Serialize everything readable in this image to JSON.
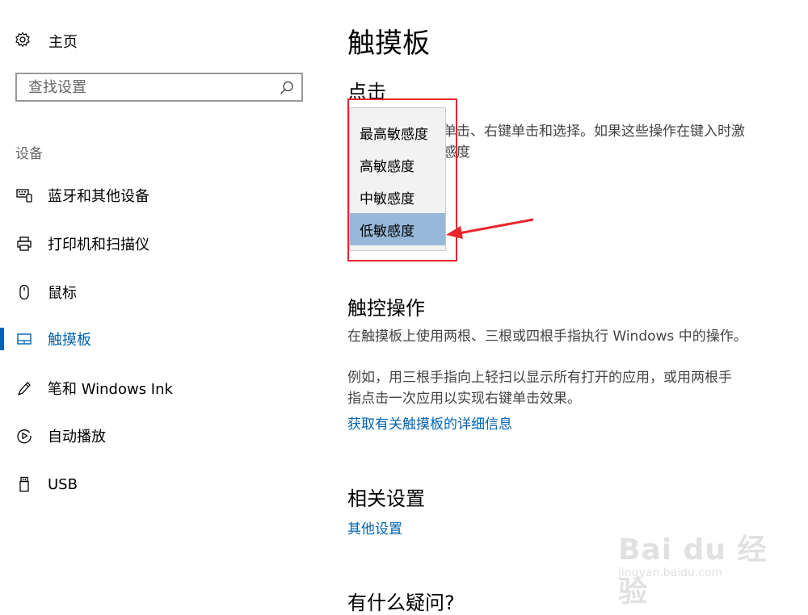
{
  "sidebar": {
    "home_label": "主页",
    "search_placeholder": "查找设置",
    "section_label": "设备",
    "items": [
      {
        "label": "蓝牙和其他设备",
        "icon": "bluetooth-devices-icon"
      },
      {
        "label": "打印机和扫描仪",
        "icon": "printer-icon"
      },
      {
        "label": "鼠标",
        "icon": "mouse-icon"
      },
      {
        "label": "触摸板",
        "icon": "touchpad-icon",
        "active": true
      },
      {
        "label": "笔和 Windows Ink",
        "icon": "pen-icon"
      },
      {
        "label": "自动播放",
        "icon": "autoplay-icon"
      },
      {
        "label": "USB",
        "icon": "usb-icon"
      }
    ]
  },
  "main": {
    "title": "触摸板",
    "tap_heading": "点击",
    "tap_desc_line1": "单击、右键单击和选择。如果这些操作在键入时激",
    "tap_desc_line2": "感度",
    "sensitivity_options": [
      "最高敏感度",
      "高敏感度",
      "中敏感度",
      "低敏感度"
    ],
    "selected_option": "低敏感度",
    "gestures_heading": "触控操作",
    "gestures_desc": "在触摸板上使用两根、三根或四根手指执行 Windows 中的操作。",
    "gestures_example_line1": "例如，用三根手指向上轻扫以显示所有打开的应用，或用两根手",
    "gestures_example_line2": "指点击一次应用以实现右键单击效果。",
    "gestures_link": "获取有关触摸板的详细信息",
    "related_heading": "相关设置",
    "related_link": "其他设置",
    "faq_heading": "有什么疑问?"
  },
  "watermark": {
    "main": "Bai du 经验",
    "sub": "jingyan.baidu.com"
  },
  "colors": {
    "accent": "#0063b1",
    "highlight": "#e8262c",
    "selected": "#97b8d9"
  }
}
